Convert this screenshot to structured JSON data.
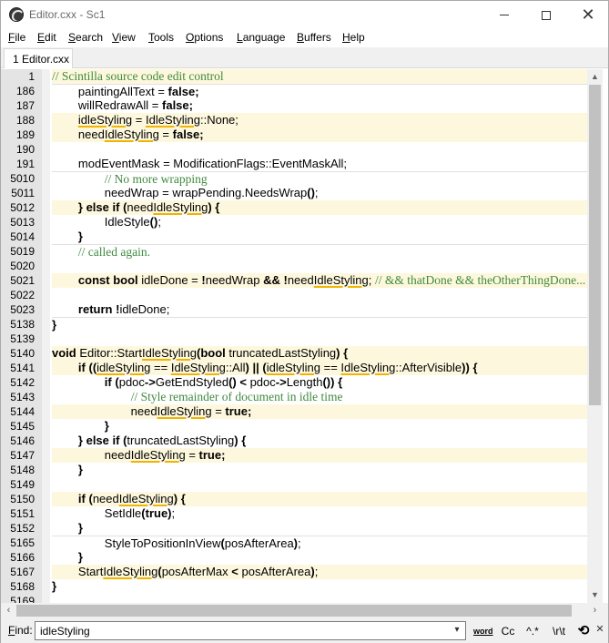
{
  "window": {
    "title": "Editor.cxx - Sc1",
    "minimize_glyph": "",
    "maximize_glyph": "",
    "close_glyph": "✕"
  },
  "menu": [
    {
      "label": "File",
      "accel": "F",
      "rest": "ile"
    },
    {
      "label": "Edit",
      "accel": "E",
      "rest": "dit"
    },
    {
      "label": "Search",
      "accel": "S",
      "rest": "earch"
    },
    {
      "label": "View",
      "accel": "V",
      "rest": "iew"
    },
    {
      "label": "Tools",
      "accel": "T",
      "rest": "ools"
    },
    {
      "label": "Options",
      "accel": "O",
      "rest": "ptions"
    },
    {
      "label": "Language",
      "accel": "L",
      "rest": "anguage"
    },
    {
      "label": "Buffers",
      "accel": "B",
      "rest": "uffers"
    },
    {
      "label": "Help",
      "accel": "H",
      "rest": "elp"
    }
  ],
  "tab": {
    "label": "1 Editor.cxx"
  },
  "editor": {
    "highlight_color": "#fdf8dd",
    "comment_color": "#3f8a3f",
    "marker_color": "#f0b400",
    "lines": [
      {
        "num": "1",
        "hl": true,
        "tokens": [
          [
            "cm",
            "// Scintilla source code edit control"
          ]
        ]
      },
      {
        "num": "186",
        "sep": true,
        "tokens": [
          [
            "",
            "        paintingAllText = "
          ],
          [
            "kw",
            "false"
          ],
          [
            "op",
            ";"
          ]
        ]
      },
      {
        "num": "187",
        "tokens": [
          [
            "",
            "        willRedrawAll = "
          ],
          [
            "kw",
            "false"
          ],
          [
            "op",
            ";"
          ]
        ]
      },
      {
        "num": "188",
        "hl": true,
        "tokens": [
          [
            "",
            "        "
          ],
          [
            "mk",
            "idleStyling"
          ],
          [
            "",
            " = "
          ],
          [
            "mk",
            "IdleStyling"
          ],
          [
            "",
            "::None;"
          ]
        ]
      },
      {
        "num": "189",
        "hl": true,
        "tokens": [
          [
            "",
            "        need"
          ],
          [
            "mk",
            "IdleStyling"
          ],
          [
            "",
            " = "
          ],
          [
            "kw",
            "false"
          ],
          [
            "op",
            ";"
          ]
        ]
      },
      {
        "num": "190",
        "tokens": [
          [
            "",
            ""
          ]
        ]
      },
      {
        "num": "191",
        "tokens": [
          [
            "",
            "        modEventMask = ModificationFlags::EventMaskAll;"
          ]
        ]
      },
      {
        "num": "5010",
        "sep": true,
        "tokens": [
          [
            "",
            "                "
          ],
          [
            "cm",
            "// No more wrapping"
          ]
        ]
      },
      {
        "num": "5011",
        "tokens": [
          [
            "",
            "                needWrap = wrapPending.NeedsWrap"
          ],
          [
            "op",
            "()"
          ],
          [
            "",
            ";"
          ]
        ]
      },
      {
        "num": "5012",
        "hl": true,
        "tokens": [
          [
            "",
            "        "
          ],
          [
            "kw",
            "} else if"
          ],
          [
            "",
            " "
          ],
          [
            "op",
            "("
          ],
          [
            "",
            "need"
          ],
          [
            "mk",
            "IdleStyling"
          ],
          [
            "op",
            ")"
          ],
          [
            "",
            " "
          ],
          [
            "op",
            "{"
          ]
        ]
      },
      {
        "num": "5013",
        "tokens": [
          [
            "",
            "                IdleStyle"
          ],
          [
            "op",
            "()"
          ],
          [
            "",
            ";"
          ]
        ]
      },
      {
        "num": "5014",
        "tokens": [
          [
            "",
            "        "
          ],
          [
            "op",
            "}"
          ]
        ]
      },
      {
        "num": "5019",
        "sep": true,
        "tokens": [
          [
            "",
            "        "
          ],
          [
            "cm",
            "// called again."
          ]
        ]
      },
      {
        "num": "5020",
        "tokens": [
          [
            "",
            ""
          ]
        ]
      },
      {
        "num": "5021",
        "hl": true,
        "tokens": [
          [
            "",
            "        "
          ],
          [
            "kw",
            "const bool"
          ],
          [
            "",
            " idleDone = "
          ],
          [
            "op",
            "!"
          ],
          [
            "",
            "needWrap "
          ],
          [
            "op",
            "&&"
          ],
          [
            "",
            " "
          ],
          [
            "op",
            "!"
          ],
          [
            "",
            "need"
          ],
          [
            "mk",
            "IdleStyling"
          ],
          [
            "",
            "; "
          ],
          [
            "cm",
            "// && thatDone && theOtherThingDone..."
          ]
        ]
      },
      {
        "num": "5022",
        "tokens": [
          [
            "",
            ""
          ]
        ]
      },
      {
        "num": "5023",
        "tokens": [
          [
            "",
            "        "
          ],
          [
            "kw",
            "return"
          ],
          [
            "",
            " "
          ],
          [
            "op",
            "!"
          ],
          [
            "",
            "idleDone;"
          ]
        ]
      },
      {
        "num": "5138",
        "sep": true,
        "tokens": [
          [
            "op",
            "}"
          ]
        ]
      },
      {
        "num": "5139",
        "tokens": [
          [
            "",
            ""
          ]
        ]
      },
      {
        "num": "5140",
        "hl": true,
        "tokens": [
          [
            "kw",
            "void"
          ],
          [
            "",
            " Editor::Start"
          ],
          [
            "mk",
            "IdleStyling"
          ],
          [
            "op",
            "("
          ],
          [
            "kw",
            "bool"
          ],
          [
            "",
            " truncatedLastStyling"
          ],
          [
            "op",
            ")"
          ],
          [
            "",
            " "
          ],
          [
            "op",
            "{"
          ]
        ]
      },
      {
        "num": "5141",
        "hl": true,
        "tokens": [
          [
            "",
            "        "
          ],
          [
            "kw",
            "if"
          ],
          [
            "",
            " "
          ],
          [
            "op",
            "(("
          ],
          [
            "mk",
            "idleStyling"
          ],
          [
            "",
            " == "
          ],
          [
            "mk",
            "IdleStyling"
          ],
          [
            "",
            "::All"
          ],
          [
            "op",
            ")"
          ],
          [
            "",
            " "
          ],
          [
            "op",
            "||"
          ],
          [
            "",
            " "
          ],
          [
            "op",
            "("
          ],
          [
            "mk",
            "idleStyling"
          ],
          [
            "",
            " == "
          ],
          [
            "mk",
            "IdleStyling"
          ],
          [
            "",
            "::AfterVisible"
          ],
          [
            "op",
            "))"
          ],
          [
            "",
            " "
          ],
          [
            "op",
            "{"
          ]
        ]
      },
      {
        "num": "5142",
        "tokens": [
          [
            "",
            "                "
          ],
          [
            "kw",
            "if"
          ],
          [
            "",
            " "
          ],
          [
            "op",
            "("
          ],
          [
            "",
            "pdoc"
          ],
          [
            "op",
            "->"
          ],
          [
            "",
            "GetEndStyled"
          ],
          [
            "op",
            "()"
          ],
          [
            "",
            " "
          ],
          [
            "op",
            "<"
          ],
          [
            "",
            " pdoc"
          ],
          [
            "op",
            "->"
          ],
          [
            "",
            "Length"
          ],
          [
            "op",
            "())"
          ],
          [
            "",
            " "
          ],
          [
            "op",
            "{"
          ]
        ]
      },
      {
        "num": "5143",
        "tokens": [
          [
            "",
            "                        "
          ],
          [
            "cm",
            "// Style remainder of document in idle time"
          ]
        ]
      },
      {
        "num": "5144",
        "hl": true,
        "tokens": [
          [
            "",
            "                        need"
          ],
          [
            "mk",
            "IdleStyling"
          ],
          [
            "",
            " = "
          ],
          [
            "kw",
            "true"
          ],
          [
            "op",
            ";"
          ]
        ]
      },
      {
        "num": "5145",
        "tokens": [
          [
            "",
            "                "
          ],
          [
            "op",
            "}"
          ]
        ]
      },
      {
        "num": "5146",
        "tokens": [
          [
            "",
            "        "
          ],
          [
            "op",
            "}"
          ],
          [
            "",
            " "
          ],
          [
            "kw",
            "else if"
          ],
          [
            "",
            " "
          ],
          [
            "op",
            "("
          ],
          [
            "",
            "truncatedLastStyling"
          ],
          [
            "op",
            ")"
          ],
          [
            "",
            " "
          ],
          [
            "op",
            "{"
          ]
        ]
      },
      {
        "num": "5147",
        "hl": true,
        "tokens": [
          [
            "",
            "                need"
          ],
          [
            "mk",
            "IdleStyling"
          ],
          [
            "",
            " = "
          ],
          [
            "kw",
            "true"
          ],
          [
            "op",
            ";"
          ]
        ]
      },
      {
        "num": "5148",
        "tokens": [
          [
            "",
            "        "
          ],
          [
            "op",
            "}"
          ]
        ]
      },
      {
        "num": "5149",
        "tokens": [
          [
            "",
            ""
          ]
        ]
      },
      {
        "num": "5150",
        "hl": true,
        "tokens": [
          [
            "",
            "        "
          ],
          [
            "kw",
            "if"
          ],
          [
            "",
            " "
          ],
          [
            "op",
            "("
          ],
          [
            "",
            "need"
          ],
          [
            "mk",
            "IdleStyling"
          ],
          [
            "op",
            ")"
          ],
          [
            "",
            " "
          ],
          [
            "op",
            "{"
          ]
        ]
      },
      {
        "num": "5151",
        "tokens": [
          [
            "",
            "                SetIdle"
          ],
          [
            "op",
            "("
          ],
          [
            "kw",
            "true"
          ],
          [
            "op",
            ")"
          ],
          [
            "",
            ";"
          ]
        ]
      },
      {
        "num": "5152",
        "tokens": [
          [
            "",
            "        "
          ],
          [
            "op",
            "}"
          ]
        ]
      },
      {
        "num": "5165",
        "sep": true,
        "tokens": [
          [
            "",
            "                StyleToPositionInView"
          ],
          [
            "op",
            "("
          ],
          [
            "",
            "posAfterArea"
          ],
          [
            "op",
            ")"
          ],
          [
            "",
            ";"
          ]
        ]
      },
      {
        "num": "5166",
        "tokens": [
          [
            "",
            "        "
          ],
          [
            "op",
            "}"
          ]
        ]
      },
      {
        "num": "5167",
        "hl": true,
        "tokens": [
          [
            "",
            "        Start"
          ],
          [
            "mk",
            "IdleStyling"
          ],
          [
            "op",
            "("
          ],
          [
            "",
            "posAfterMax "
          ],
          [
            "op",
            "<"
          ],
          [
            "",
            " posAfterArea"
          ],
          [
            "op",
            ")"
          ],
          [
            "",
            ";"
          ]
        ]
      },
      {
        "num": "5168",
        "tokens": [
          [
            "op",
            "}"
          ]
        ]
      },
      {
        "num": "5169",
        "tokens": [
          [
            "",
            ""
          ]
        ]
      }
    ]
  },
  "scroll": {
    "up": "▲",
    "down": "▼",
    "left": "‹",
    "right": "›",
    "vertical_position": 0.0,
    "horizontal_position": 0.0
  },
  "find": {
    "label_accel": "F",
    "label_rest": "ind:",
    "value": "idleStyling",
    "dropdown": "▾",
    "opt_word": "word",
    "opt_case": "Cc",
    "opt_regex": "^.*",
    "opt_backslash": "\\r\\t",
    "opt_wrap": "⟲",
    "close": "✕"
  }
}
